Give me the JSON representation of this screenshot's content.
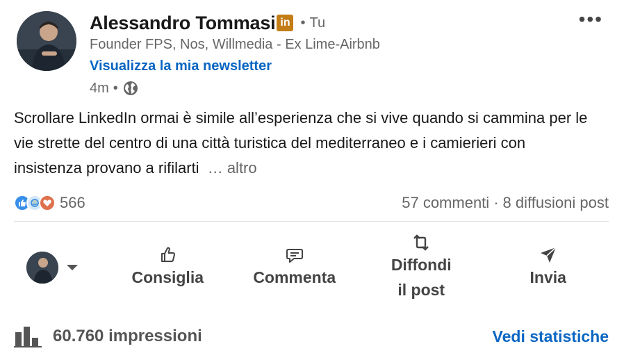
{
  "author": {
    "name": "Alessandro Tommasi",
    "badge": "in",
    "degree": "Tu",
    "headline": "Founder FPS, Nos, Willmedia - Ex Lime-Airbnb",
    "newsletter_link": "Visualizza la mia newsletter",
    "time": "4m",
    "visibility_icon": "globe-icon"
  },
  "post": {
    "text": "Scrollare LinkedIn ormai è simile all’esperienza che si vive quando si cammina per le vie strette del centro di una città turistica del mediterraneo e i camierieri con insistenza provano a rifilarti",
    "see_more": "… altro"
  },
  "social": {
    "reaction_icons": [
      "like-reaction-icon",
      "funny-reaction-icon",
      "love-reaction-icon"
    ],
    "reaction_count": "566",
    "comments": "57 commenti",
    "reposts": "8 diffusioni post"
  },
  "actions": {
    "like": "Consiglia",
    "comment": "Commenta",
    "repost_line1": "Diffondi",
    "repost_line2": "il post",
    "send": "Invia"
  },
  "footer": {
    "impressions": "60.760 impressioni",
    "insights": "Vedi statistiche"
  },
  "colors": {
    "link": "#0a66c2",
    "muted": "#666666",
    "badge": "#c37d16"
  }
}
